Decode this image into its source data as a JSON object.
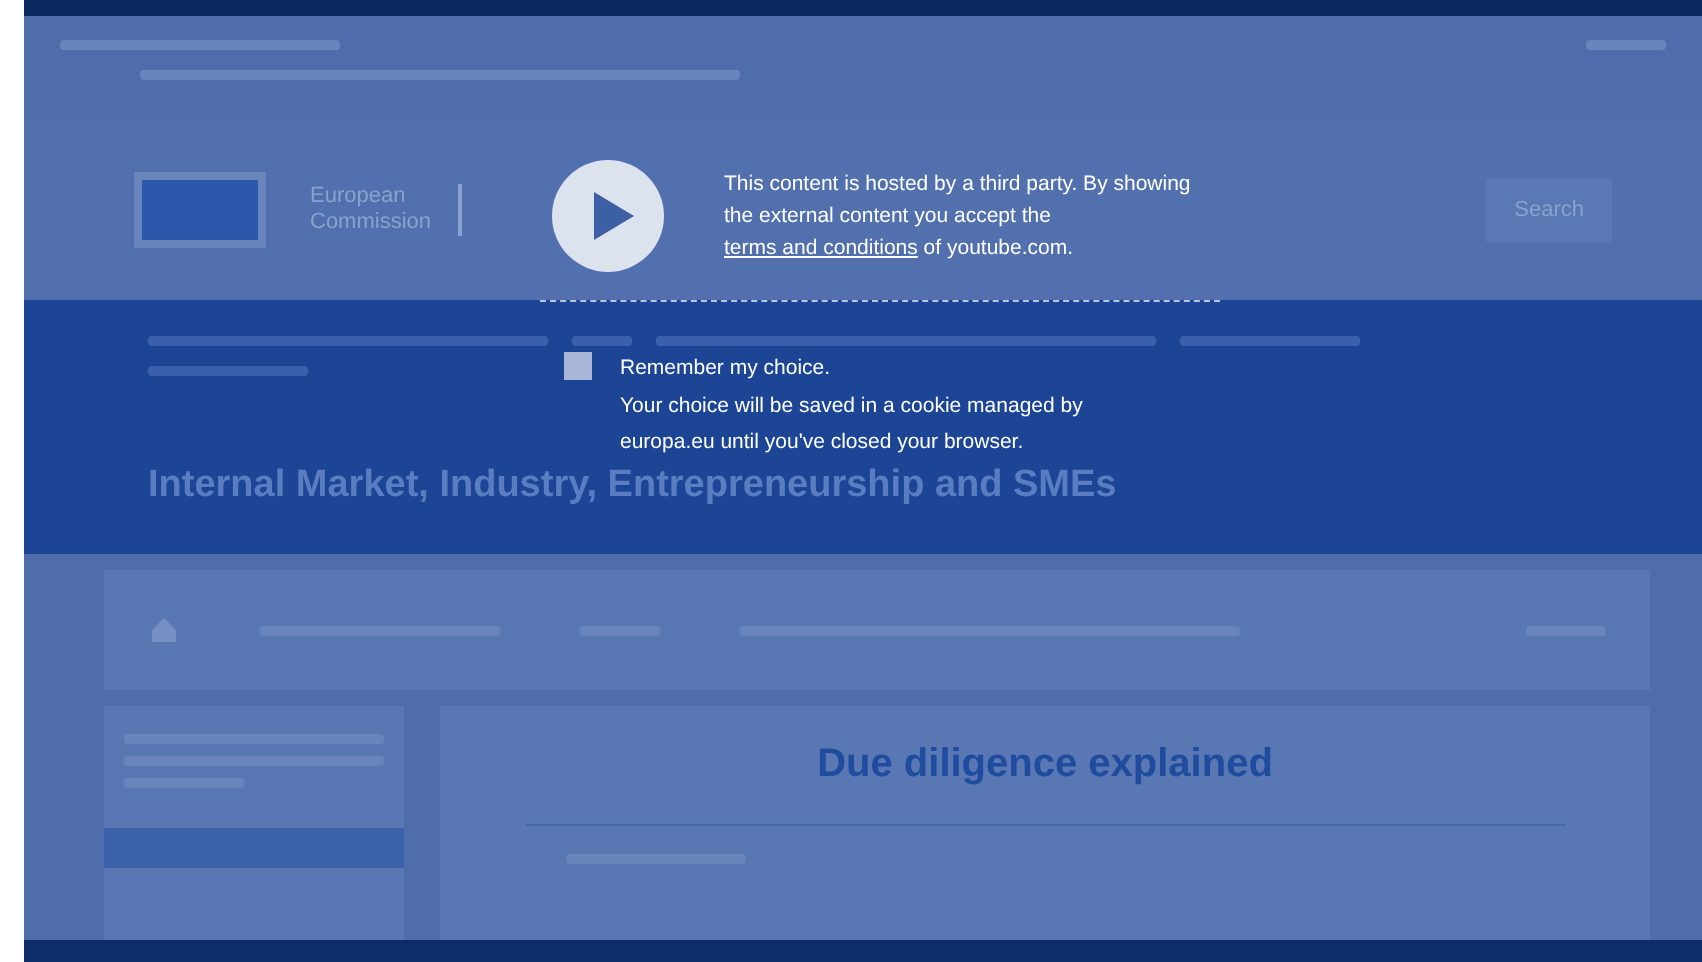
{
  "video_frame": {
    "header": {
      "logo_text": "European Commission",
      "search_button": "Search"
    },
    "site_title": "Internal Market, Industry, Entrepreneurship and SMEs",
    "page_heading": "Due diligence explained"
  },
  "consent": {
    "message_start": "This content is hosted by a third party. By showing the external content you accept the",
    "terms_link": "terms and conditions",
    "message_end": "of youtube.com.",
    "remember": {
      "label": "Remember my choice.",
      "checked": false
    },
    "note": "Your choice will be saved in a cookie managed by europa.eu until you've closed your browser."
  }
}
